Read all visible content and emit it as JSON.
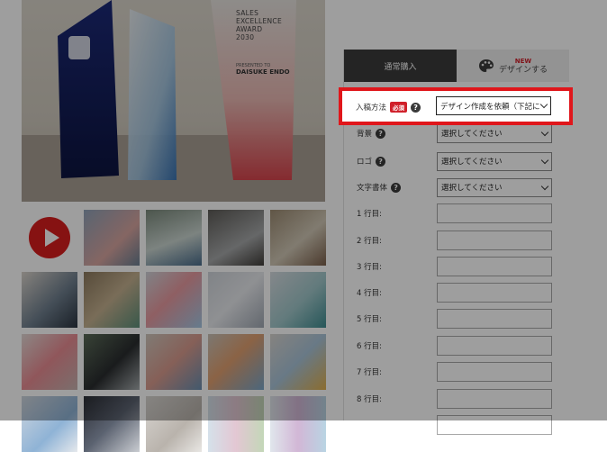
{
  "hero": {
    "award_lines": "SALES\nEXCELLENCE\nAWARD\n2030",
    "presented_to": "PRESENTED TO",
    "recipient": "DAISUKE ENDO"
  },
  "tabs": {
    "normal": "通常購入",
    "design_new": "NEW",
    "design": "デザインする"
  },
  "form": {
    "submission_method": {
      "label": "入稿方法",
      "required": "必須",
      "value": "デザイン作成を依頼（下記に"
    },
    "background": {
      "label": "背景",
      "value": "選択してください"
    },
    "logo": {
      "label": "ロゴ",
      "value": "選択してください"
    },
    "font": {
      "label": "文字書体",
      "value": "選択してください"
    },
    "lines": [
      {
        "label": "1 行目:"
      },
      {
        "label": "2 行目:"
      },
      {
        "label": "3 行目:"
      },
      {
        "label": "4 行目:"
      },
      {
        "label": "5 行目:"
      },
      {
        "label": "6 行目:"
      },
      {
        "label": "7 行目:"
      },
      {
        "label": "8 行目:"
      }
    ]
  },
  "colors": {
    "highlight": "#e0161b",
    "required_badge": "#d0202a",
    "play_button": "#d81e1e",
    "tab_active": "#3a3a3a"
  },
  "icons": [
    "help-icon",
    "palette-icon",
    "play-icon",
    "chevron-down-icon"
  ]
}
